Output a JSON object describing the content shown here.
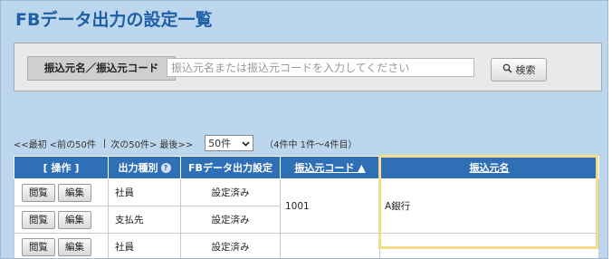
{
  "page": {
    "title": "FBデータ出力の設定一覧"
  },
  "search": {
    "label": "振込元名／振込元コード",
    "placeholder": "振込元名または振込元コードを入力してください",
    "button_label": "検索",
    "button_icon": "search-icon"
  },
  "pager": {
    "first": "<<最初",
    "prev": "<前の50件",
    "separator": "|",
    "next": "次の50件>",
    "last": "最後>>",
    "page_size": "50件",
    "range": "（4件中 1件～4件目）"
  },
  "table": {
    "headers": {
      "ops": "[ 操作 ]",
      "type": "出力種別",
      "status": "FBデータ出力設定",
      "code": "振込元コード ▲",
      "name": "振込元名"
    },
    "view_label": "閲覧",
    "edit_label": "編集",
    "group": {
      "code": "1001",
      "name": "A銀行"
    },
    "rows": [
      {
        "type": "社員",
        "status": "設定済み"
      },
      {
        "type": "支払先",
        "status": "設定済み"
      },
      {
        "type": "社員",
        "status": "設定済み"
      }
    ]
  },
  "colors": {
    "header_bg": "#2f6fb6",
    "page_bg": "#bcd7ed",
    "title": "#1f5fa6",
    "highlight": "#f3dd8a"
  }
}
